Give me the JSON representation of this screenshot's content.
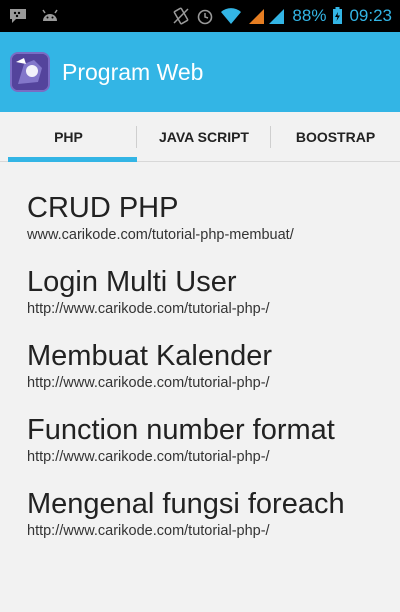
{
  "status_bar": {
    "battery": "88%",
    "time": "09:23"
  },
  "action_bar": {
    "title": "Program Web"
  },
  "tabs": [
    {
      "label": "PHP",
      "active": true
    },
    {
      "label": "JAVA SCRIPT",
      "active": false
    },
    {
      "label": "BOOSTRAP",
      "active": false
    }
  ],
  "items": [
    {
      "title": "CRUD PHP",
      "url": "www.carikode.com/tutorial-php-membuat/"
    },
    {
      "title": "Login Multi User",
      "url": "http://www.carikode.com/tutorial-php-/"
    },
    {
      "title": "Membuat Kalender",
      "url": "http://www.carikode.com/tutorial-php-/"
    },
    {
      "title": "Function number format",
      "url": "http://www.carikode.com/tutorial-php-/"
    },
    {
      "title": "Mengenal fungsi foreach",
      "url": "http://www.carikode.com/tutorial-php-/"
    }
  ],
  "colors": {
    "accent": "#33b5e5",
    "status_bar_bg": "#000000",
    "background": "#f2f2f2"
  },
  "icons": [
    "bbm-icon",
    "android-icon",
    "vibrate-icon",
    "alarm-icon",
    "wifi-icon",
    "signal-icon",
    "battery-icon",
    "app-icon"
  ]
}
